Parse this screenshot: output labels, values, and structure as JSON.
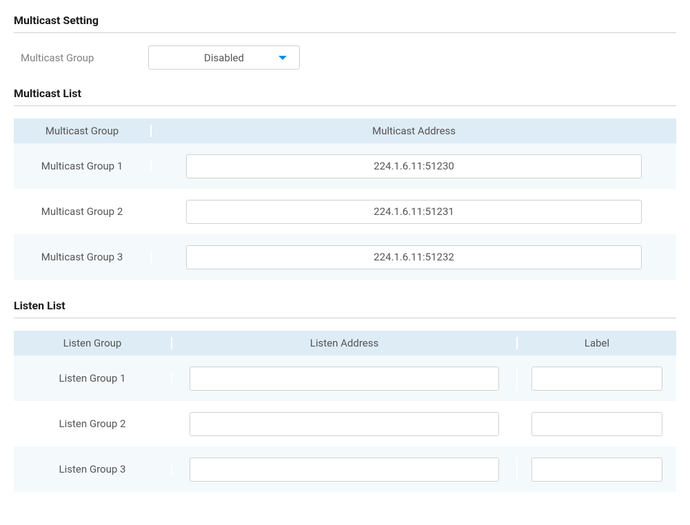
{
  "sections": {
    "multicast_setting": {
      "title": "Multicast Setting",
      "group_label": "Multicast Group",
      "group_value": "Disabled"
    },
    "multicast_list": {
      "title": "Multicast List",
      "headers": {
        "group": "Multicast Group",
        "address": "Multicast Address"
      },
      "rows": [
        {
          "group": "Multicast Group 1",
          "address": "224.1.6.11:51230"
        },
        {
          "group": "Multicast Group 2",
          "address": "224.1.6.11:51231"
        },
        {
          "group": "Multicast Group 3",
          "address": "224.1.6.11:51232"
        }
      ]
    },
    "listen_list": {
      "title": "Listen List",
      "headers": {
        "group": "Listen Group",
        "address": "Listen Address",
        "label": "Label"
      },
      "rows": [
        {
          "group": "Listen Group 1",
          "address": "",
          "label": ""
        },
        {
          "group": "Listen Group 2",
          "address": "",
          "label": ""
        },
        {
          "group": "Listen Group 3",
          "address": "",
          "label": ""
        }
      ]
    }
  }
}
